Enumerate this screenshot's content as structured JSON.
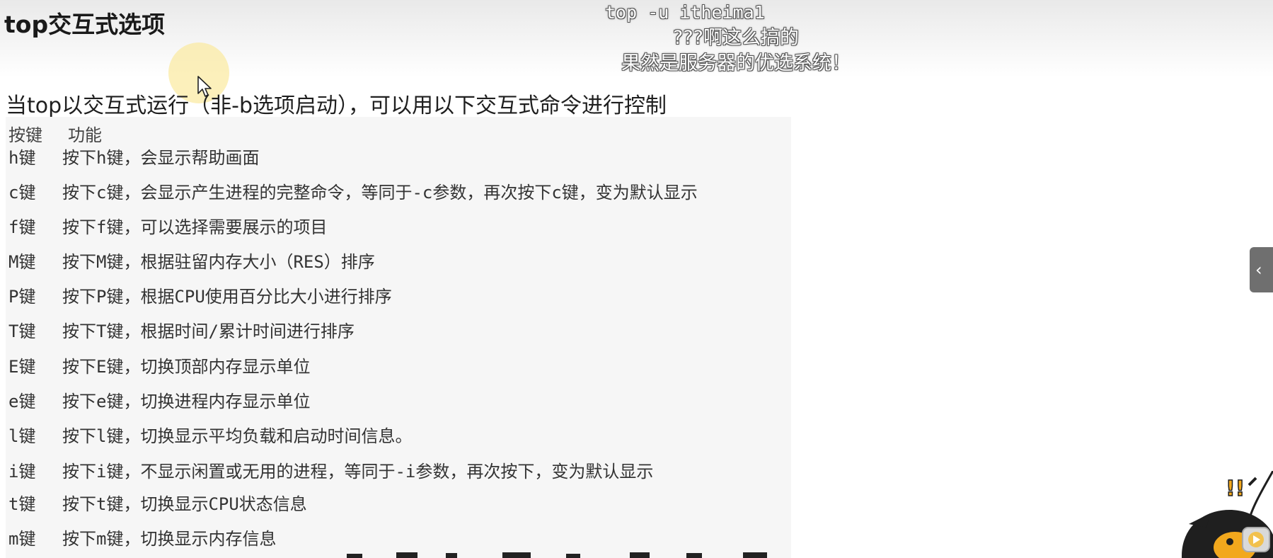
{
  "page": {
    "title": "top交互式选项",
    "intro": "当top以交互式运行（非-b选项启动），可以用以下交互式命令进行控制"
  },
  "subtitles": {
    "command": "top -u itheima1",
    "line1": "???啊这么搞的",
    "line2": "果然是服务器的优选系统！"
  },
  "table": {
    "headers": [
      "按键",
      "功能"
    ],
    "rows": [
      {
        "key": "h键",
        "desc": "按下h键，会显示帮助画面"
      },
      {
        "key": "c键",
        "desc": "按下c键，会显示产生进程的完整命令，等同于-c参数，再次按下c键，变为默认显示"
      },
      {
        "key": "f键",
        "desc": "按下f键，可以选择需要展示的项目"
      },
      {
        "key": "M键",
        "desc": "按下M键，根据驻留内存大小（RES）排序"
      },
      {
        "key": "P键",
        "desc": "按下P键，根据CPU使用百分比大小进行排序"
      },
      {
        "key": "T键",
        "desc": "按下T键，根据时间/累计时间进行排序"
      },
      {
        "key": "E键",
        "desc": "按下E键，切换顶部内存显示单位"
      },
      {
        "key": "e键",
        "desc": "按下e键，切换进程内存显示单位"
      },
      {
        "key": "l键",
        "desc": "按下l键，切换显示平均负载和启动时间信息。"
      },
      {
        "key": "i键",
        "desc": "按下i键，不显示闲置或无用的进程，等同于-i参数，再次按下，变为默认显示"
      },
      {
        "key": "t键",
        "desc": "按下t键，切换显示CPU状态信息"
      },
      {
        "key": "m键",
        "desc": "按下m键，切换显示内存信息"
      }
    ]
  },
  "side_tab": {
    "icon": "chevron-left-icon",
    "glyph": "‹"
  },
  "colors": {
    "table_bg": "#f6f6f6",
    "cursor_halo": "#fae896",
    "side_tab": "#6f6f6f"
  }
}
